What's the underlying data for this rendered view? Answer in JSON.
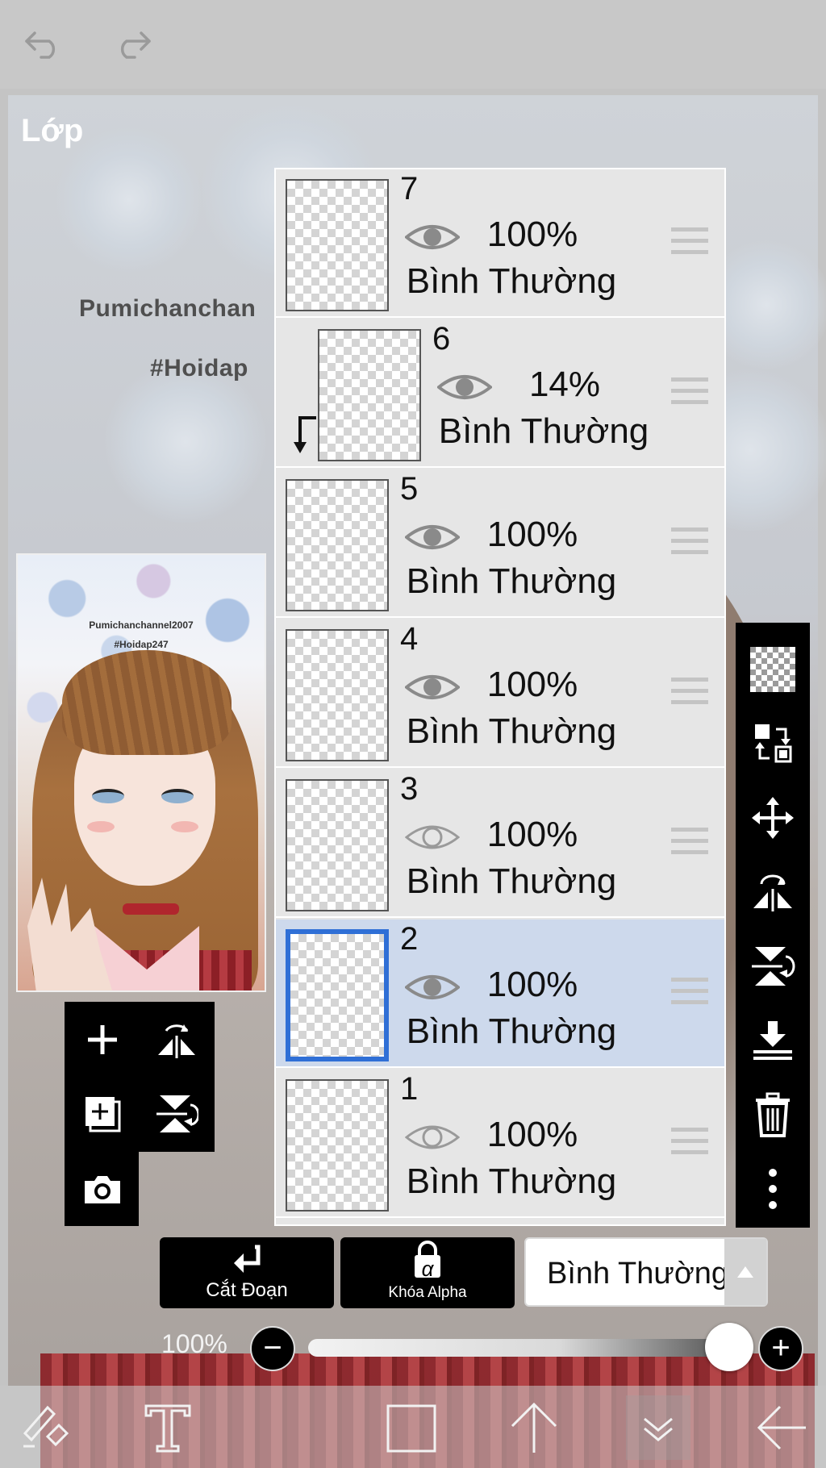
{
  "panel": {
    "title": "Lớp"
  },
  "watermark": {
    "line1": "Pumichanchan",
    "line2": "#Hoidap"
  },
  "thumbnail": {
    "line1": "Pumichanchannel2007",
    "line2": "#Hoidap247"
  },
  "layers": [
    {
      "num": "7",
      "opacity": "100%",
      "mode": "Bình Thường",
      "visible": true,
      "selected": false,
      "clipped": false
    },
    {
      "num": "6",
      "opacity": "14%",
      "mode": "Bình Thường",
      "visible": true,
      "selected": false,
      "clipped": true
    },
    {
      "num": "5",
      "opacity": "100%",
      "mode": "Bình Thường",
      "visible": true,
      "selected": false,
      "clipped": false
    },
    {
      "num": "4",
      "opacity": "100%",
      "mode": "Bình Thường",
      "visible": true,
      "selected": false,
      "clipped": false
    },
    {
      "num": "3",
      "opacity": "100%",
      "mode": "Bình Thường",
      "visible": false,
      "selected": false,
      "clipped": false
    },
    {
      "num": "2",
      "opacity": "100%",
      "mode": "Bình Thường",
      "visible": true,
      "selected": true,
      "clipped": false
    },
    {
      "num": "1",
      "opacity": "100%",
      "mode": "Bình Thường",
      "visible": false,
      "selected": false,
      "clipped": false
    }
  ],
  "bottom_controls": {
    "clip_label": "Cắt Đoạn",
    "alpha_lock_label": "Khóa Alpha",
    "alpha_symbol": "α",
    "blend_mode": "Bình Thường",
    "opacity_label": "100%",
    "opacity_value": 1.0
  },
  "colors": {
    "accent": "#2f6fd6",
    "selected_row": "#cdd9ec",
    "toolbar": "#000000"
  },
  "icons": {
    "top": [
      "undo-icon",
      "redo-icon"
    ],
    "left_tools": [
      "add-layer-icon",
      "flip-horizontal-icon",
      "add-from-canvas-icon",
      "flip-vertical-icon",
      "camera-icon"
    ],
    "right_tools": [
      "transparency-icon",
      "swap-layer-icon",
      "move-icon",
      "flip-horizontal-icon",
      "flip-vertical-icon",
      "merge-down-icon",
      "trash-icon",
      "more-icon"
    ],
    "bottom": [
      "brush-eraser-icon",
      "text-icon",
      "canvas-frame-icon",
      "up-arrow-icon",
      "chevron-down-icon",
      "back-arrow-icon"
    ]
  }
}
